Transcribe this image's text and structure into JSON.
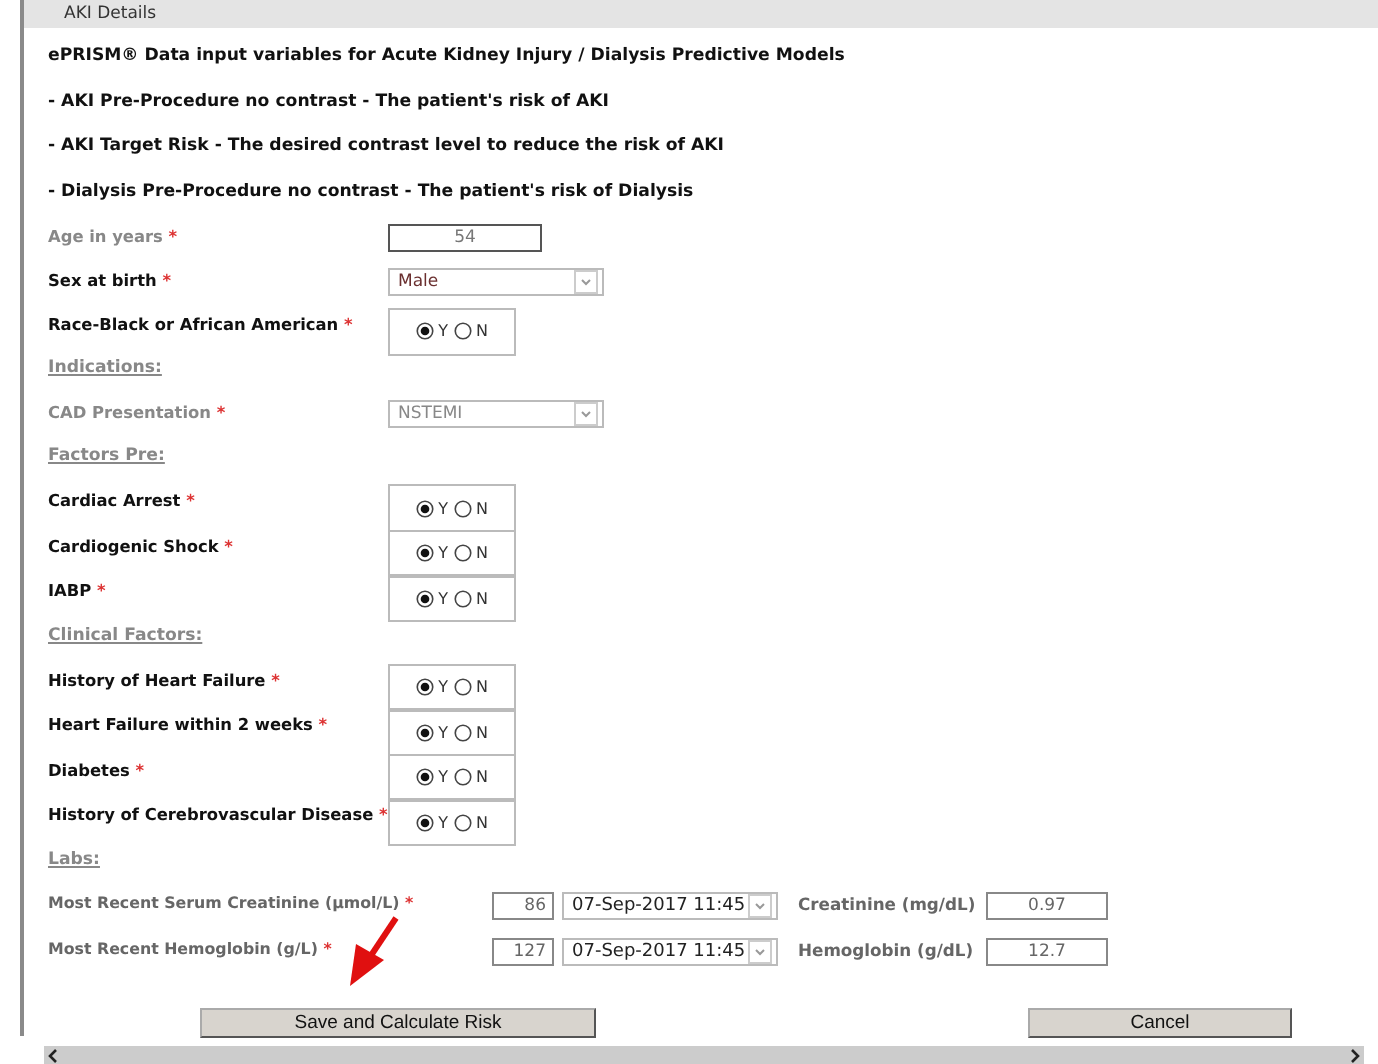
{
  "panel": {
    "title": "AKI Details"
  },
  "intro": [
    "ePRISM® Data input variables for Acute Kidney Injury / Dialysis Predictive Models",
    "- AKI Pre-Procedure no contrast - The patient's risk of AKI",
    "- AKI Target Risk - The desired contrast level to reduce the risk of AKI",
    "- Dialysis Pre-Procedure no contrast - The patient's risk of Dialysis"
  ],
  "fields": [
    {
      "kind": "text",
      "label": "Age in years",
      "required": "*",
      "value": "54",
      "disabled": true
    },
    {
      "kind": "select",
      "label": "Sex at birth",
      "required": "*",
      "value": "Male",
      "disabled": false
    },
    {
      "kind": "radio",
      "label": "Race-Black or African American",
      "required": "*",
      "options": [
        {
          "label": "Y",
          "selected": true
        },
        {
          "label": "N",
          "selected": false
        }
      ]
    },
    {
      "kind": "section",
      "label": "Indications:"
    },
    {
      "kind": "select",
      "label": "CAD Presentation",
      "required": "*",
      "value": "NSTEMI",
      "disabled": true
    },
    {
      "kind": "section",
      "label": "Factors Pre:"
    },
    {
      "kind": "radio",
      "label": "Cardiac Arrest",
      "required": "*",
      "options": [
        {
          "label": "Y",
          "selected": true
        },
        {
          "label": "N",
          "selected": false
        }
      ]
    },
    {
      "kind": "radio",
      "label": "Cardiogenic Shock",
      "required": "*",
      "options": [
        {
          "label": "Y",
          "selected": true
        },
        {
          "label": "N",
          "selected": false
        }
      ]
    },
    {
      "kind": "radio",
      "label": "IABP",
      "required": "*",
      "options": [
        {
          "label": "Y",
          "selected": true
        },
        {
          "label": "N",
          "selected": false
        }
      ]
    },
    {
      "kind": "section",
      "label": "Clinical Factors:"
    },
    {
      "kind": "radio",
      "label": "History of Heart Failure",
      "required": "*",
      "options": [
        {
          "label": "Y",
          "selected": true
        },
        {
          "label": "N",
          "selected": false
        }
      ]
    },
    {
      "kind": "radio",
      "label": "Heart Failure within 2 weeks",
      "required": "*",
      "options": [
        {
          "label": "Y",
          "selected": true
        },
        {
          "label": "N",
          "selected": false
        }
      ]
    },
    {
      "kind": "radio",
      "label": "Diabetes",
      "required": "*",
      "options": [
        {
          "label": "Y",
          "selected": true
        },
        {
          "label": "N",
          "selected": false
        }
      ]
    },
    {
      "kind": "radio",
      "label": "History of Cerebrovascular Disease",
      "required": "*",
      "options": [
        {
          "label": "Y",
          "selected": true
        },
        {
          "label": "N",
          "selected": false
        }
      ]
    },
    {
      "kind": "section",
      "label": "Labs:"
    }
  ],
  "labs": [
    {
      "label": "Most Recent Serum Creatinine (µmol/L)",
      "required": "*",
      "value": "86",
      "date": "07-Sep-2017 11:45",
      "converted_label": "Creatinine (mg/dL)",
      "converted_value": "0.97"
    },
    {
      "label": "Most Recent Hemoglobin (g/L)",
      "required": "*",
      "value": "127",
      "date": "07-Sep-2017 11:45",
      "converted_label": "Hemoglobin (g/dL)",
      "converted_value": "12.7"
    }
  ],
  "buttons": [
    "Save and Calculate Risk",
    "Cancel"
  ]
}
